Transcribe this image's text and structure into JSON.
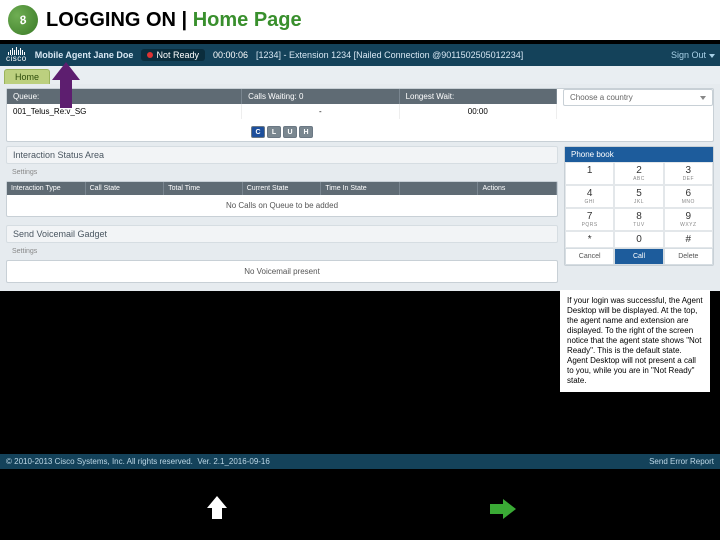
{
  "slide": {
    "badge_number": "8",
    "title_prefix": "LOGGING ON | ",
    "title_highlight": "Home Page"
  },
  "app_header": {
    "vendor": "cisco",
    "agent_label": "Mobile Agent",
    "agent_name": "Jane Doe",
    "status": "Not Ready",
    "timer": "00:00:06",
    "extension_info": "[1234] - Extension 1234 [Nailed Connection @9011502505012234]",
    "signout": "Sign Out"
  },
  "tabs": {
    "home": "Home"
  },
  "queue": {
    "headers": {
      "queue": "Queue:",
      "calls": "Calls Waiting: 0",
      "longest": "Longest Wait:"
    },
    "row": {
      "name": "001_Telus_Re:v_SG",
      "calls": "-",
      "longest": "00:00"
    },
    "acw_buttons": [
      "C",
      "L",
      "U",
      "H"
    ]
  },
  "country": {
    "placeholder": "Choose a country"
  },
  "interaction": {
    "title": "Interaction Status Area",
    "settings": "Settings",
    "columns": [
      "Interaction Type",
      "Call State",
      "Total Time",
      "Current State",
      "Time In State",
      "",
      "Actions"
    ],
    "empty": "No Calls on Queue to be added"
  },
  "voicemail": {
    "title": "Send Voicemail Gadget",
    "settings": "Settings",
    "empty": "No Voicemail present"
  },
  "phone_book": {
    "title": "Phone book",
    "keys": [
      {
        "n": "1",
        "l": ""
      },
      {
        "n": "2",
        "l": "ABC"
      },
      {
        "n": "3",
        "l": "DEF"
      },
      {
        "n": "4",
        "l": "GHI"
      },
      {
        "n": "5",
        "l": "JKL"
      },
      {
        "n": "6",
        "l": "MNO"
      },
      {
        "n": "7",
        "l": "PQRS"
      },
      {
        "n": "8",
        "l": "TUV"
      },
      {
        "n": "9",
        "l": "WXYZ"
      },
      {
        "n": "*",
        "l": ""
      },
      {
        "n": "0",
        "l": ""
      },
      {
        "n": "#",
        "l": ""
      }
    ],
    "actions": {
      "cancel": "Cancel",
      "call": "Call",
      "delete": "Delete"
    }
  },
  "note": "If your login was successful, the Agent Desktop will be displayed. At the top, the agent name and extension are displayed. To the right of the screen notice that the agent state shows \"Not Ready\". This is the default state. Agent Desktop will not present a call to you, while you are in \"Not Ready\" state.",
  "footer": {
    "copyright": "© 2010-2013 Cisco Systems, Inc. All rights reserved.",
    "version": "Ver. 2.1_2016-09-16",
    "error_link": "Send Error Report"
  }
}
